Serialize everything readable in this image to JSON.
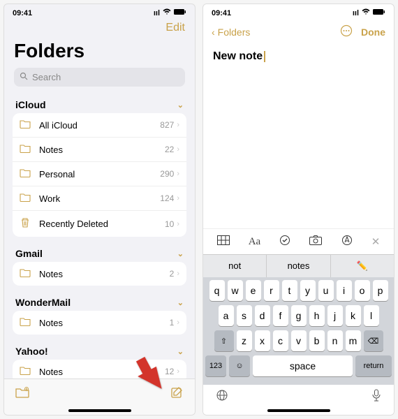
{
  "status": {
    "time": "09:41",
    "loc": "↗",
    "signal": "••ıl",
    "wifi": "✓",
    "batt": "■"
  },
  "left": {
    "edit": "Edit",
    "title": "Folders",
    "search_placeholder": "Search",
    "sections": [
      {
        "name": "iCloud",
        "items": [
          {
            "icon": "folder",
            "label": "All iCloud",
            "count": "827"
          },
          {
            "icon": "folder",
            "label": "Notes",
            "count": "22"
          },
          {
            "icon": "folder",
            "label": "Personal",
            "count": "290"
          },
          {
            "icon": "folder",
            "label": "Work",
            "count": "124"
          },
          {
            "icon": "trash",
            "label": "Recently Deleted",
            "count": "10"
          }
        ]
      },
      {
        "name": "Gmail",
        "items": [
          {
            "icon": "folder",
            "label": "Notes",
            "count": "2"
          }
        ]
      },
      {
        "name": "WonderMail",
        "items": [
          {
            "icon": "folder",
            "label": "Notes",
            "count": "1"
          }
        ]
      },
      {
        "name": "Yahoo!",
        "items": [
          {
            "icon": "folder",
            "label": "Notes",
            "count": "12"
          }
        ]
      }
    ]
  },
  "right": {
    "back": "Folders",
    "done": "Done",
    "note_title": "New note",
    "suggestions": [
      "not",
      "notes",
      "✏️"
    ],
    "keys_row1": [
      "q",
      "w",
      "e",
      "r",
      "t",
      "y",
      "u",
      "i",
      "o",
      "p"
    ],
    "keys_row2": [
      "a",
      "s",
      "d",
      "f",
      "g",
      "h",
      "j",
      "k",
      "l"
    ],
    "keys_row3": [
      "z",
      "x",
      "c",
      "v",
      "b",
      "n",
      "m"
    ],
    "key_123": "123",
    "key_space": "space",
    "key_return": "return"
  }
}
